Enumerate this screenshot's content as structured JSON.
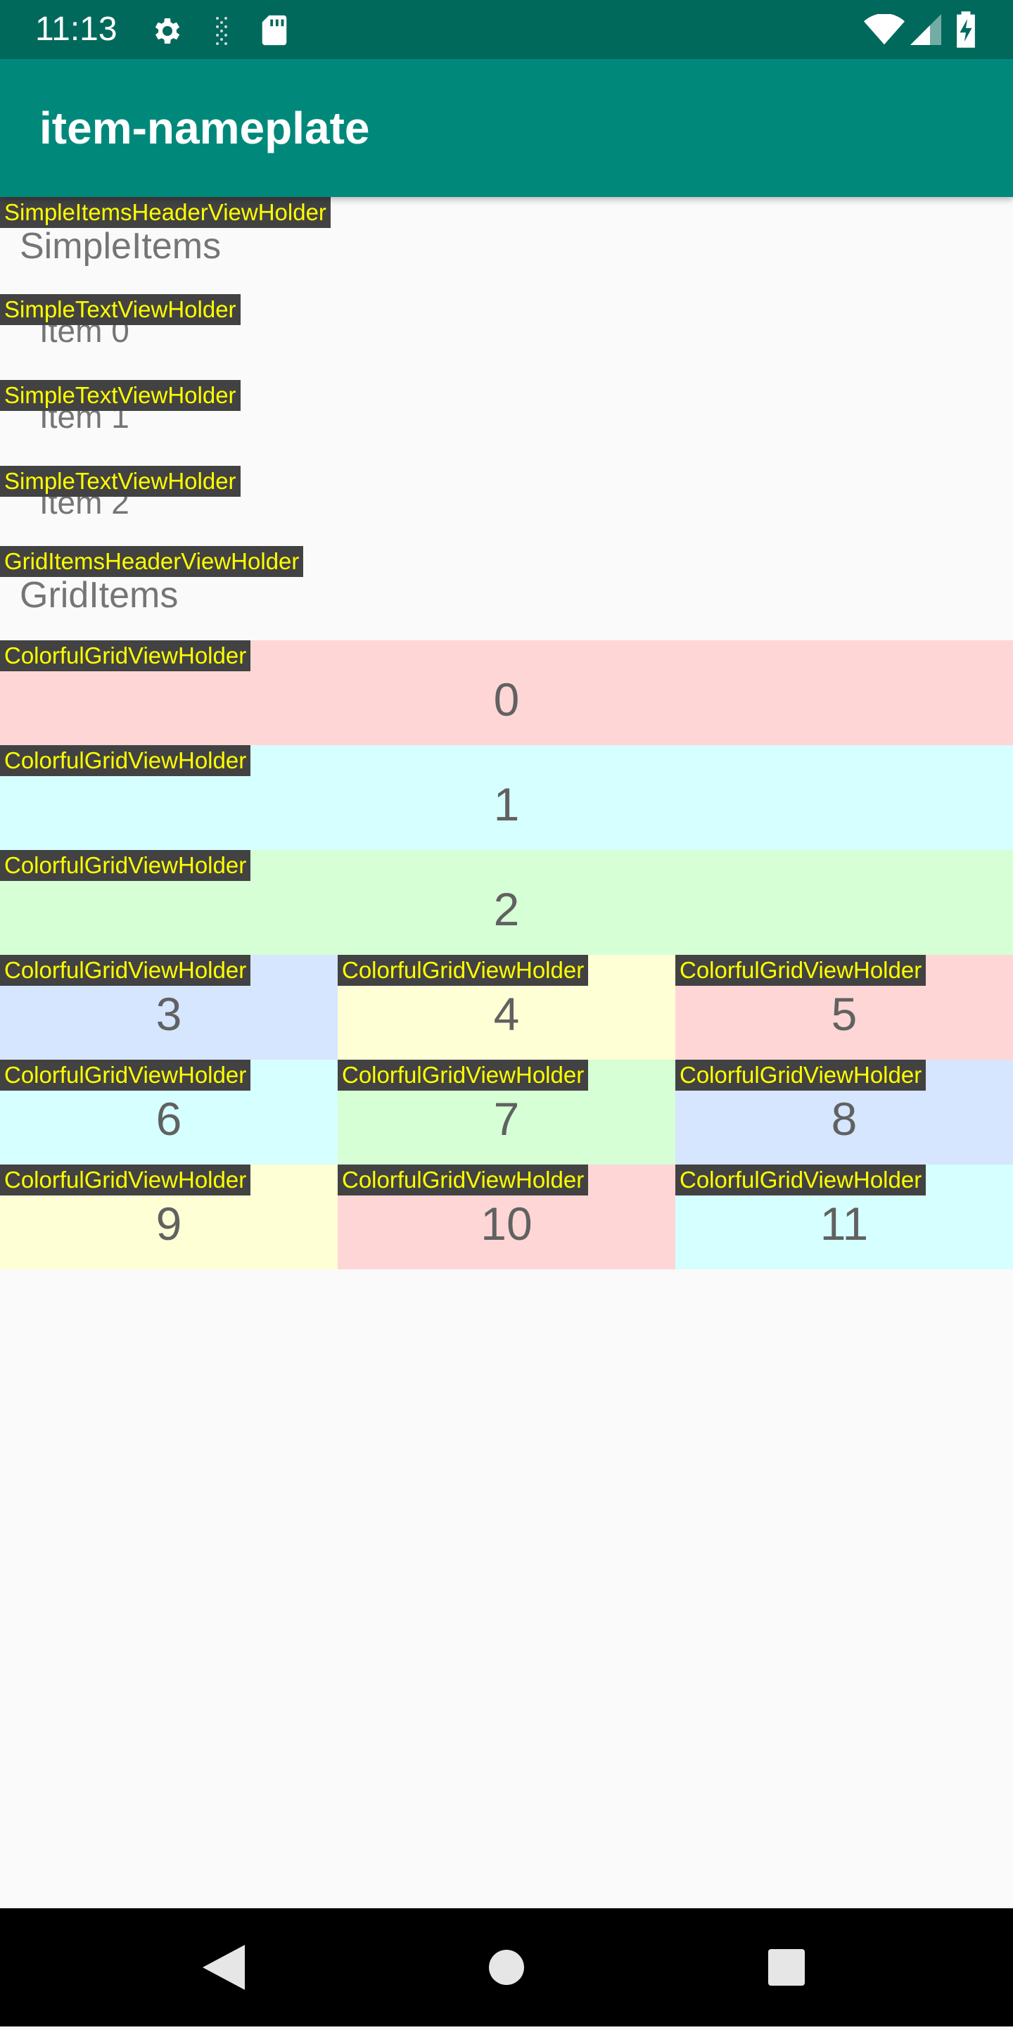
{
  "status_bar": {
    "time": "11:13",
    "icons": [
      "settings-icon",
      "signal-dots-icon",
      "sd-card-icon",
      "wifi-icon",
      "cell-signal-icon",
      "battery-charging-icon"
    ]
  },
  "app_bar": {
    "title": "item-nameplate"
  },
  "list": {
    "simple_header": {
      "nameplate": "SimpleItemsHeaderViewHolder",
      "label": "SimpleItems"
    },
    "simple_items": [
      {
        "nameplate": "SimpleTextViewHolder",
        "label": "Item 0"
      },
      {
        "nameplate": "SimpleTextViewHolder",
        "label": "Item 1"
      },
      {
        "nameplate": "SimpleTextViewHolder",
        "label": "Item 2"
      }
    ],
    "grid_header": {
      "nameplate": "GridItemsHeaderViewHolder",
      "label": "GridItems"
    },
    "grid_items": [
      {
        "nameplate": "ColorfulGridViewHolder",
        "label": "0",
        "color": "#ffd6d6"
      },
      {
        "nameplate": "ColorfulGridViewHolder",
        "label": "1",
        "color": "#d6ffff"
      },
      {
        "nameplate": "ColorfulGridViewHolder",
        "label": "2",
        "color": "#d6ffd6"
      },
      {
        "nameplate": "ColorfulGridViewHolder",
        "label": "3",
        "color": "#d6e6ff"
      },
      {
        "nameplate": "ColorfulGridViewHolder",
        "label": "4",
        "color": "#ffffd6"
      },
      {
        "nameplate": "ColorfulGridViewHolder",
        "label": "5",
        "color": "#ffd6d6"
      },
      {
        "nameplate": "ColorfulGridViewHolder",
        "label": "6",
        "color": "#d6ffff"
      },
      {
        "nameplate": "ColorfulGridViewHolder",
        "label": "7",
        "color": "#d6ffd6"
      },
      {
        "nameplate": "ColorfulGridViewHolder",
        "label": "8",
        "color": "#d6e6ff"
      },
      {
        "nameplate": "ColorfulGridViewHolder",
        "label": "9",
        "color": "#ffffd6"
      },
      {
        "nameplate": "ColorfulGridViewHolder",
        "label": "10",
        "color": "#ffd6d6"
      },
      {
        "nameplate": "ColorfulGridViewHolder",
        "label": "11",
        "color": "#d6ffff"
      }
    ]
  },
  "nav_bar": {
    "buttons": [
      "back-icon",
      "home-icon",
      "recents-icon"
    ]
  },
  "colors": {
    "status_bar": "#00695c",
    "app_bar": "#00897b",
    "nameplate_bg": "#424242",
    "nameplate_text": "#ffff00"
  }
}
